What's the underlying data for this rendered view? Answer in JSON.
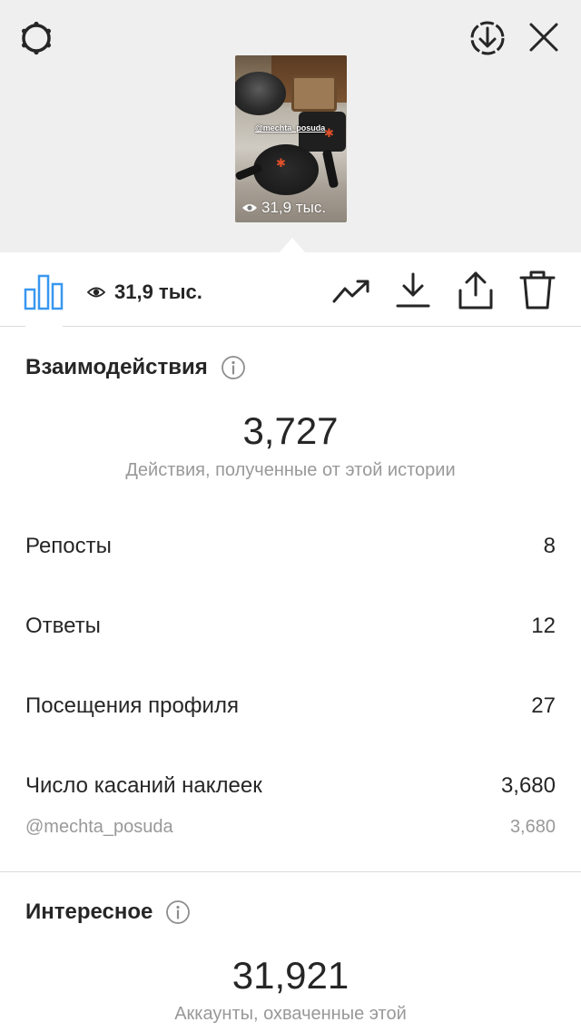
{
  "header": {
    "settings_icon": "gear-outline-icon",
    "download_circle_icon": "download-circle-icon",
    "close_icon": "close-icon"
  },
  "story_preview": {
    "sticker_text": "@mechta_posuda",
    "views_label": "31,9 тыс."
  },
  "toolbar": {
    "insights_icon": "bar-chart-icon",
    "views_icon": "eye-icon",
    "views_label": "31,9 тыс.",
    "promote_icon": "trending-up-icon",
    "download_icon": "download-icon",
    "share_icon": "share-icon",
    "delete_icon": "trash-icon",
    "accent_color": "#3897f0"
  },
  "interactions": {
    "title": "Взаимодействия",
    "total": "3,727",
    "total_caption": "Действия, полученные от этой истории",
    "rows": [
      {
        "label": "Репосты",
        "value": "8"
      },
      {
        "label": "Ответы",
        "value": "12"
      },
      {
        "label": "Посещения профиля",
        "value": "27"
      },
      {
        "label": "Число касаний наклеек",
        "value": "3,680"
      }
    ],
    "sub_row": {
      "label": "@mechta_posuda",
      "value": "3,680"
    }
  },
  "discovery": {
    "title": "Интересное",
    "total": "31,921",
    "total_caption": "Аккаунты, охваченные этой"
  }
}
